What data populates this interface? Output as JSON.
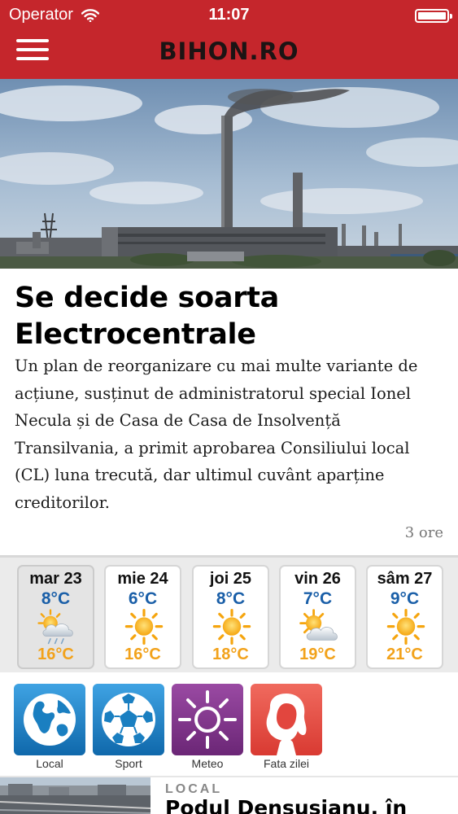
{
  "status_bar": {
    "carrier": "Operator",
    "time": "11:07"
  },
  "header": {
    "logo": "BIHON.RO"
  },
  "featured": {
    "title": "Se decide soarta Electrocentrale",
    "summary": "Un plan de reorganizare cu mai multe variante de acțiune, susținut de administratorul special Ionel Necula și de Casa de Casa de Insolvență Transilvania, a primit aprobarea Consiliului local (CL) luna trecută, dar ultimul cuvânt aparține creditorilor.",
    "age": "3 ore"
  },
  "weather": {
    "days": [
      {
        "day": "mar 23",
        "temp_top": "8°C",
        "temp_bottom": "16°C",
        "icon": "cloud-rain-sun-icon"
      },
      {
        "day": "mie 24",
        "temp_top": "6°C",
        "temp_bottom": "16°C",
        "icon": "sun-icon"
      },
      {
        "day": "joi 25",
        "temp_top": "8°C",
        "temp_bottom": "18°C",
        "icon": "sun-icon"
      },
      {
        "day": "vin 26",
        "temp_top": "7°C",
        "temp_bottom": "19°C",
        "icon": "sun-cloud-icon"
      },
      {
        "day": "sâm 27",
        "temp_top": "9°C",
        "temp_bottom": "21°C",
        "icon": "sun-icon"
      }
    ]
  },
  "shortcuts": [
    {
      "label": "Local",
      "icon": "globe-icon",
      "color": "#1a7fc1"
    },
    {
      "label": "Sport",
      "icon": "soccer-ball-icon",
      "color": "#1a7fc1"
    },
    {
      "label": "Meteo",
      "icon": "sun-outline-icon",
      "color": "#7d2f86"
    },
    {
      "label": "Fata zilei",
      "icon": "woman-silhouette-icon",
      "color": "#e2463e"
    }
  ],
  "next_article": {
    "category": "LOCAL",
    "title": "Podul Densușianu, în"
  },
  "colors": {
    "header_red": "#c5262c",
    "temp_blue": "#1a5fa8",
    "temp_orange": "#f2a21b"
  }
}
